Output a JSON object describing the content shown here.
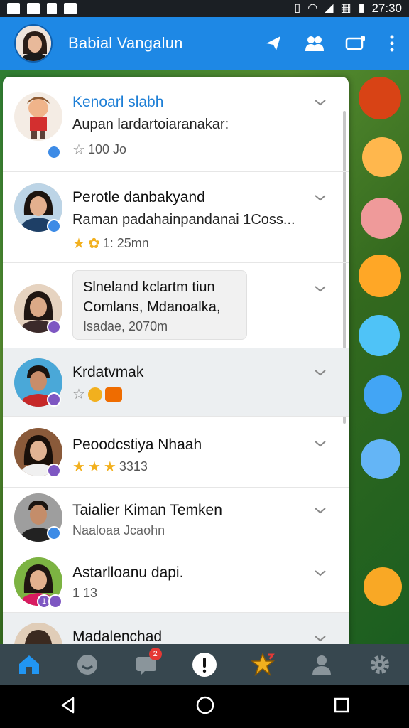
{
  "status_bar": {
    "time": "27:30"
  },
  "header": {
    "title": "Babial Vangalun"
  },
  "items": [
    {
      "title": "Kenoarl slabh",
      "subtitle": "Aupan lardartoiaranakar:",
      "meta": "100 Jo",
      "badge": "blue"
    },
    {
      "title": "Perotle danbakyand",
      "subtitle": "Raman padahainpandanai 1Coss...",
      "meta": "1: 25mn",
      "badge": "blue"
    },
    {
      "bubble": [
        "Slneland kclartm tiun",
        "Comlans, Mdanoalka,",
        "Isadae, 2070m"
      ],
      "badge": "purple"
    },
    {
      "title": "Krdatvmak",
      "meta": "",
      "badge": "purple"
    },
    {
      "title": "Peoodcstiya Nhaah",
      "meta": "3313",
      "badge": "purple"
    },
    {
      "title": "Taialier Kiman Temken",
      "subtitle": "Naaloaa Jcaohn",
      "badge": "blue"
    },
    {
      "title": "Astarlloanu dapi.",
      "meta": "1 13",
      "badge": "purple",
      "badge_text": "1"
    },
    {
      "title": "Madalenchad"
    }
  ],
  "bottom_nav": {
    "messages_badge": "2",
    "items": [
      "home",
      "chat",
      "messages",
      "notifications",
      "games",
      "profile",
      "settings"
    ]
  },
  "colors": {
    "header": "#1e88e5",
    "bottom_nav": "#37474f",
    "accent": "#1e7fd6"
  }
}
